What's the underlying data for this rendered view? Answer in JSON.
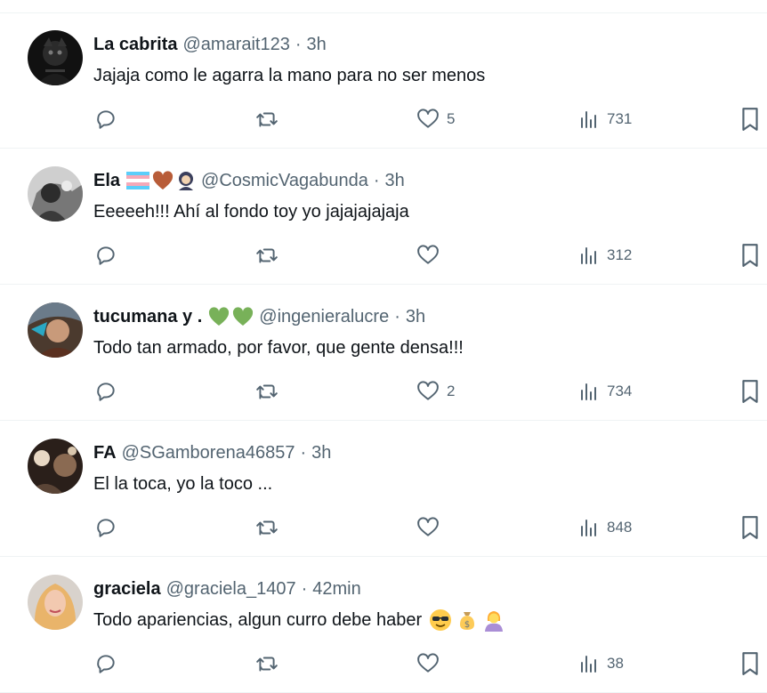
{
  "colors": {
    "text": "#0f1419",
    "secondary": "#536471",
    "divider": "#eff3f4"
  },
  "icons": {
    "reply": "reply-icon",
    "retweet": "retweet-icon",
    "like": "heart-icon",
    "views": "views-icon",
    "bookmark": "bookmark-icon"
  },
  "tweets": [
    {
      "name": "La cabrita",
      "handle": "@amarait123",
      "separator": "·",
      "time": "3h",
      "text": "Jajaja como le agarra la mano para no ser menos",
      "likes": "5",
      "views": "731"
    },
    {
      "name": "Ela",
      "name_emojis": [
        "trans-flag",
        "brown-heart",
        "person-with-headscarf"
      ],
      "handle": "@CosmicVagabunda",
      "separator": "·",
      "time": "3h",
      "text": "Eeeeeh!!! Ahí al fondo toy yo jajajajajaja",
      "likes": "",
      "views": "312"
    },
    {
      "name": "tucumana y .",
      "name_emojis": [
        "green-heart",
        "green-heart"
      ],
      "handle": "@ingenieralucre",
      "separator": "·",
      "time": "3h",
      "text": "Todo tan armado, por favor, que gente densa!!!",
      "likes": "2",
      "views": "734"
    },
    {
      "name": "FA",
      "handle": "@SGamborena46857",
      "separator": "·",
      "time": "3h",
      "text": "El la toca, yo la toco ...",
      "likes": "",
      "views": "848"
    },
    {
      "name": "graciela",
      "handle": "@graciela_1407",
      "separator": "·",
      "time": "42min",
      "text": "Todo apariencias, algun curro debe haber",
      "text_emojis": [
        "sunglasses-face",
        "money-bag",
        "person-shrugging"
      ],
      "likes": "",
      "views": "38"
    }
  ]
}
